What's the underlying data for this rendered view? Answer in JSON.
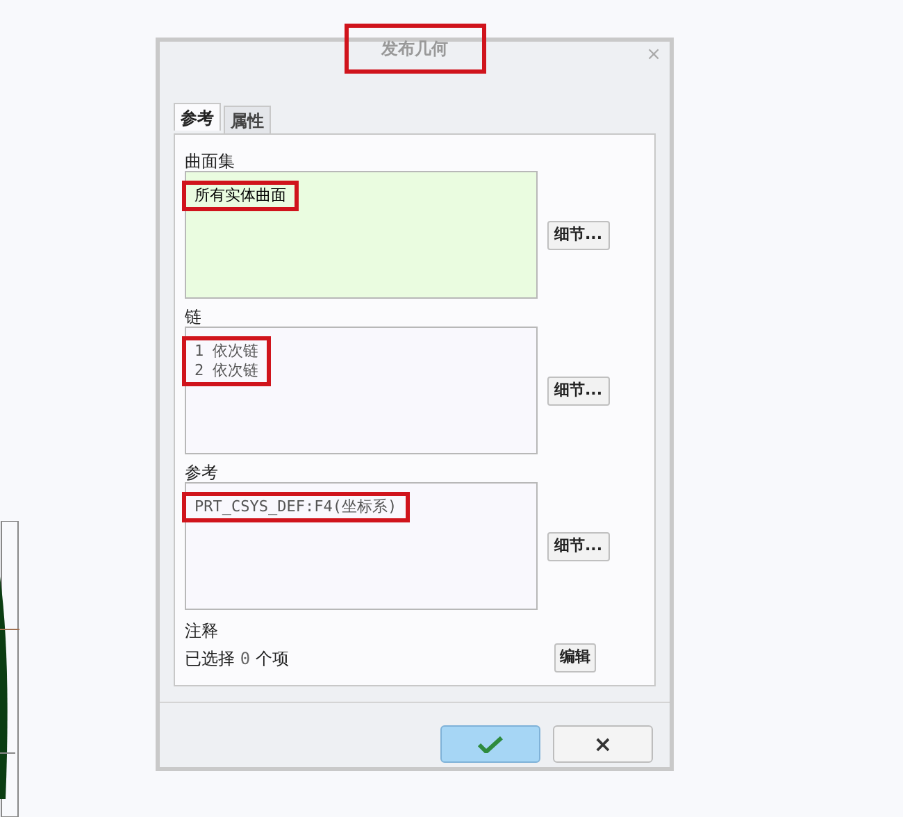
{
  "dialog": {
    "title": "发布几何",
    "title_highlighted": true,
    "close": "×",
    "tabs": [
      {
        "label": "参考",
        "selected": true
      },
      {
        "label": "属性",
        "selected": false
      }
    ],
    "sections": [
      {
        "label": "曲面集",
        "kind": "surface",
        "highlighted": true,
        "items": [
          "所有实体曲面"
        ],
        "button": "细节..."
      },
      {
        "label": "链",
        "kind": "chain",
        "highlighted": true,
        "items": [
          "1 依次链",
          "2 依次链"
        ],
        "button": "细节..."
      },
      {
        "label": "参考",
        "kind": "reference",
        "highlighted": true,
        "items": [
          "PRT_CSYS_DEF:F4(坐标系)"
        ],
        "button": "细节..."
      }
    ],
    "note": {
      "label": "注释",
      "prefix": "已选择",
      "count": "0",
      "suffix": "个项",
      "button": "编辑"
    },
    "buttons": [
      {
        "kind": "ok"
      },
      {
        "kind": "cancel",
        "label": "×"
      }
    ]
  }
}
